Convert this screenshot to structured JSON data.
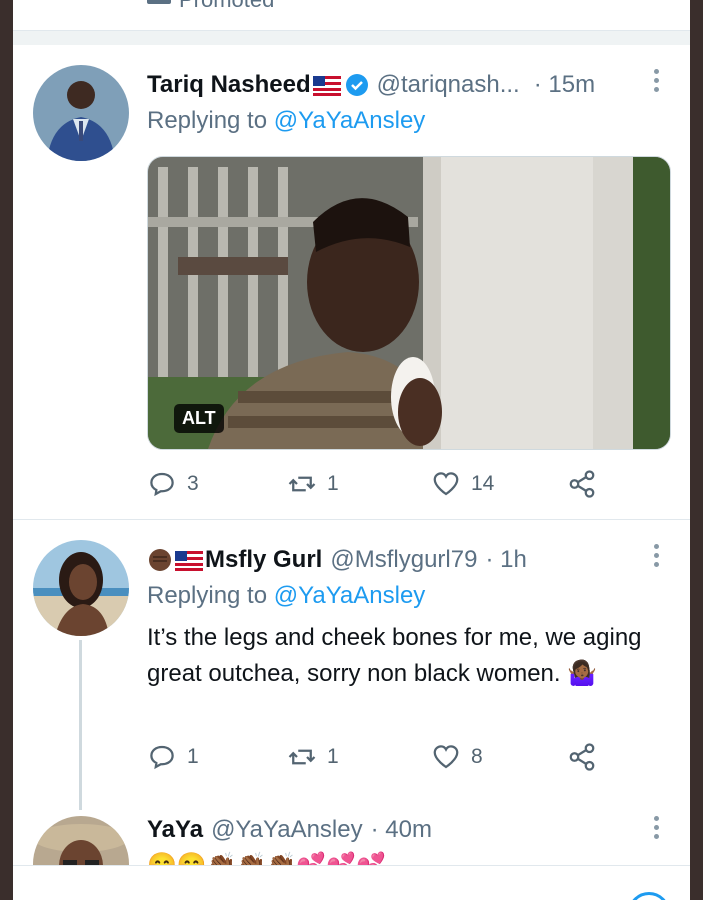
{
  "top_partial": {
    "promoted_label": "Promoted"
  },
  "tweets": [
    {
      "name": "Tariq Nasheed",
      "handle": "@tariqnash...",
      "time": "· 15m",
      "replying_prefix": "Replying to",
      "replying_to": "@YaYaAnsley",
      "media_alt_badge": "ALT",
      "replies": "3",
      "retweets": "1",
      "likes": "14"
    },
    {
      "name": "Msfly Gurl",
      "handle": "@Msflygurl79",
      "time": "· 1h",
      "replying_prefix": "Replying to",
      "replying_to": "@YaYaAnsley",
      "text": "It’s the legs and cheek bones for me, we aging great outchea, sorry non black women. 🤷🏾‍♀️",
      "replies": "1",
      "retweets": "1",
      "likes": "8"
    },
    {
      "name": "YaYa",
      "handle": "@YaYaAnsley",
      "time": "· 40m",
      "text_partial": "😊😊👏🏾👏🏾👏🏾💕💕💕"
    }
  ],
  "colors": {
    "accent": "#1d9bf0",
    "text": "#0f1419",
    "muted": "#5b7083"
  },
  "icons": [
    "verified-badge-icon",
    "us-flag-icon",
    "fist-emoji-icon",
    "more-icon",
    "reply-icon",
    "retweet-icon",
    "like-icon",
    "share-icon"
  ]
}
